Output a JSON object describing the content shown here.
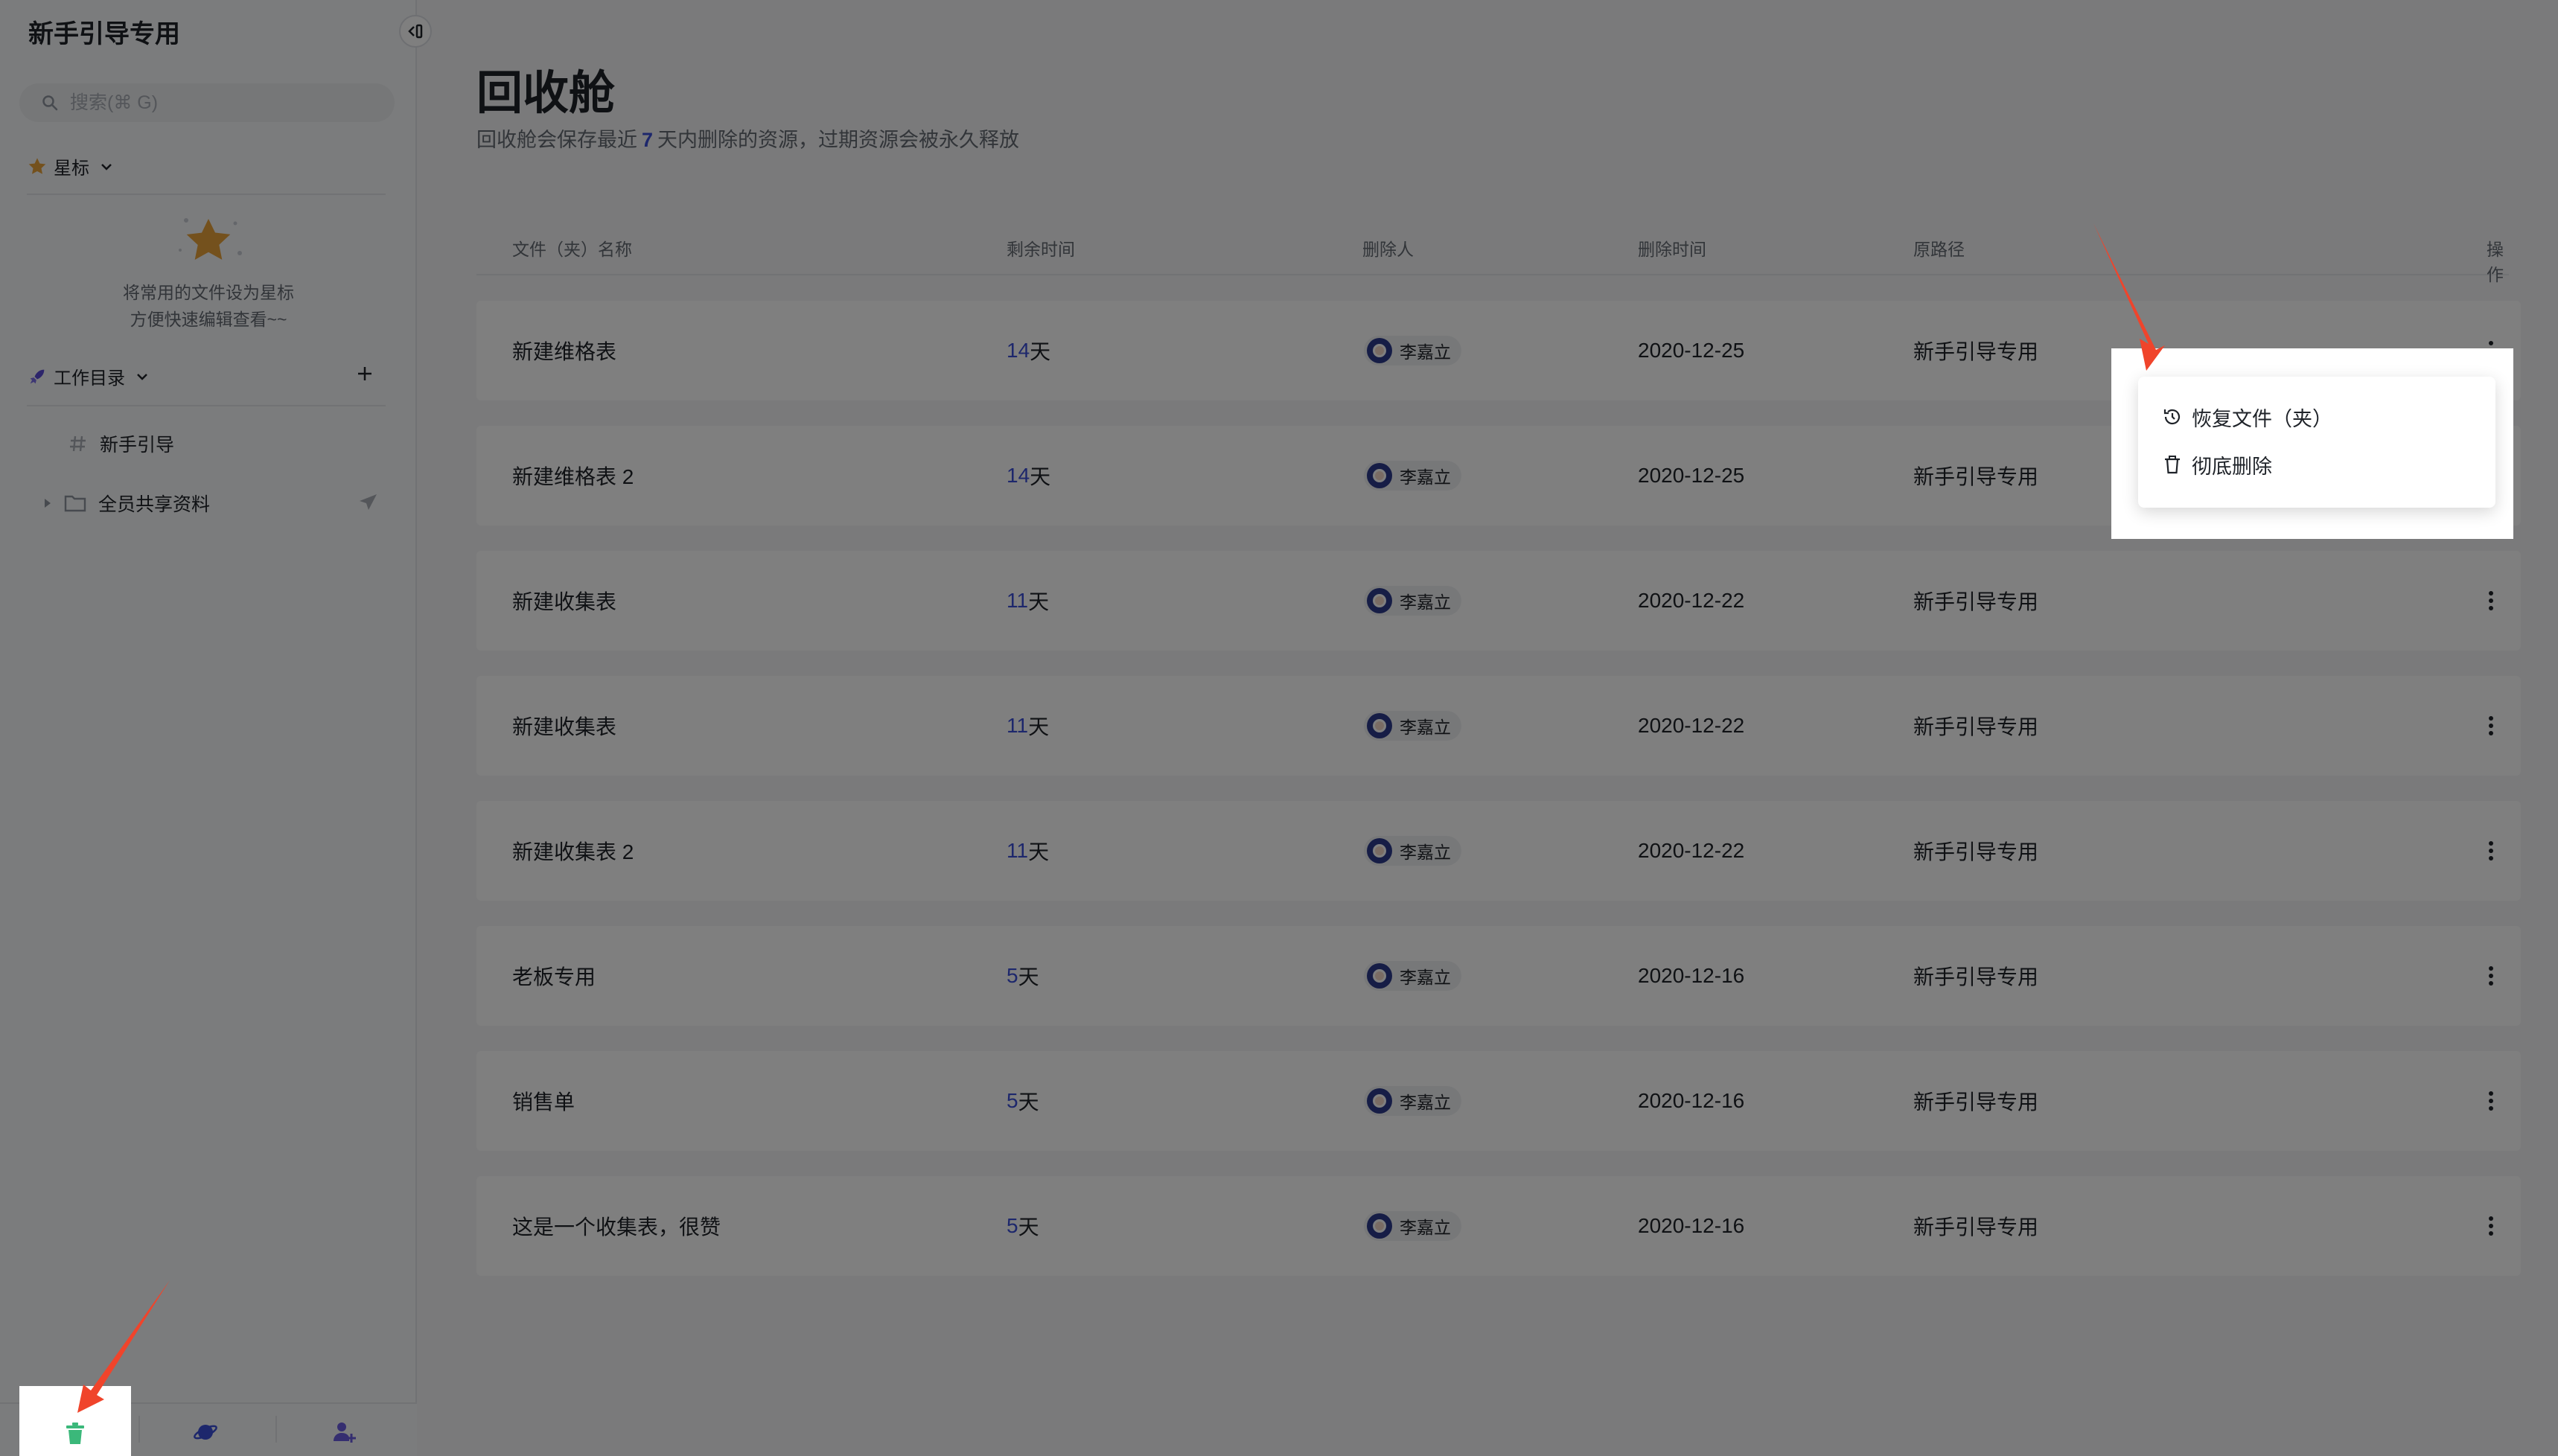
{
  "sidebar": {
    "title": "新手引导专用",
    "search_placeholder": "搜索(⌘ G)",
    "starred_label": "星标",
    "starred_hint_1": "将常用的文件设为星标",
    "starred_hint_2": "方便快速编辑查看~~",
    "workspace_label": "工作目录",
    "tree": [
      {
        "label": "新手引导",
        "icon": "hash-icon"
      },
      {
        "label": "全员共享资料",
        "icon": "folder-icon"
      }
    ]
  },
  "main": {
    "title": "回收舱",
    "subtitle_pre": "回收舱会保存最近",
    "subtitle_num": "7",
    "subtitle_post": "天内删除的资源，过期资源会被永久释放",
    "columns": {
      "name": "文件（夹）名称",
      "remaining": "剩余时间",
      "deleter": "删除人",
      "deleted_at": "删除时间",
      "path": "原路径",
      "actions": "操作"
    },
    "rows": [
      {
        "name": "新建维格表",
        "days": "14",
        "unit": "天",
        "user": "李嘉立",
        "date": "2020-12-25",
        "path": "新手引导专用"
      },
      {
        "name": "新建维格表 2",
        "days": "14",
        "unit": "天",
        "user": "李嘉立",
        "date": "2020-12-25",
        "path": "新手引导专用"
      },
      {
        "name": "新建收集表",
        "days": "11",
        "unit": "天",
        "user": "李嘉立",
        "date": "2020-12-22",
        "path": "新手引导专用"
      },
      {
        "name": "新建收集表",
        "days": "11",
        "unit": "天",
        "user": "李嘉立",
        "date": "2020-12-22",
        "path": "新手引导专用"
      },
      {
        "name": "新建收集表 2",
        "days": "11",
        "unit": "天",
        "user": "李嘉立",
        "date": "2020-12-22",
        "path": "新手引导专用"
      },
      {
        "name": "老板专用",
        "days": "5",
        "unit": "天",
        "user": "李嘉立",
        "date": "2020-12-16",
        "path": "新手引导专用"
      },
      {
        "name": "销售单",
        "days": "5",
        "unit": "天",
        "user": "李嘉立",
        "date": "2020-12-16",
        "path": "新手引导专用"
      },
      {
        "name": "这是一个收集表，很赞",
        "days": "5",
        "unit": "天",
        "user": "李嘉立",
        "date": "2020-12-16",
        "path": "新手引导专用"
      }
    ]
  },
  "menu": {
    "restore": "恢复文件（夹）",
    "delete": "彻底删除"
  },
  "colors": {
    "accent": "#3b4fd8",
    "trash_green": "#3bb87a",
    "arrow_red": "#f0442b",
    "star_gold": "#e8a33a"
  }
}
